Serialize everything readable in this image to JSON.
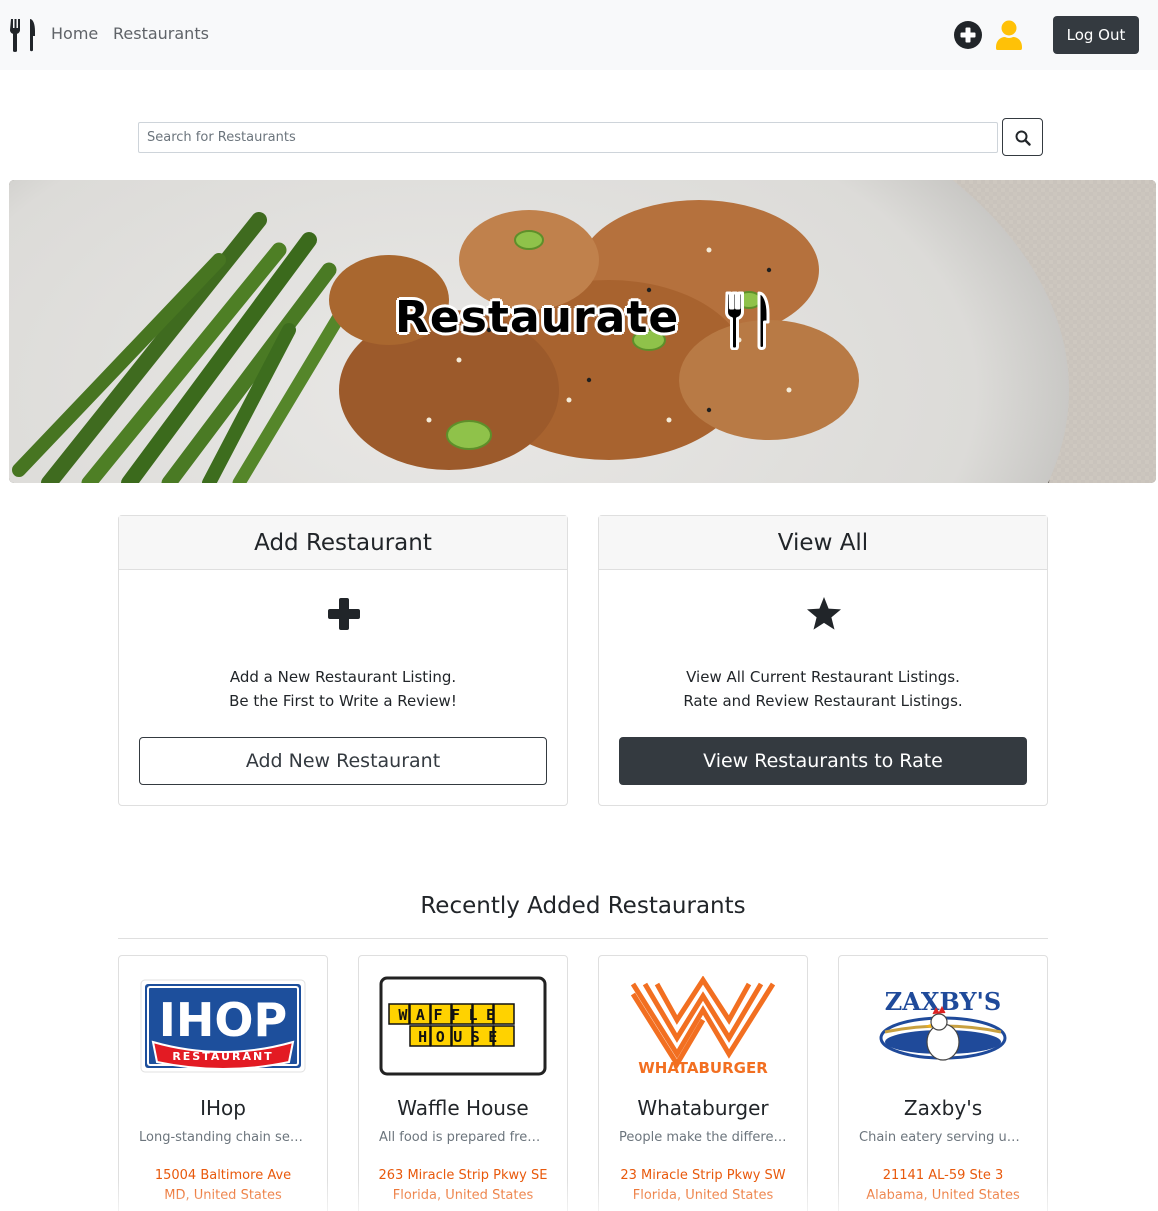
{
  "nav": {
    "home_label": "Home",
    "restaurants_label": "Restaurants",
    "logout_label": "Log Out",
    "icons": {
      "logo": "utensils-icon",
      "add": "plus-circle-icon",
      "user": "user-icon"
    },
    "user_icon_color": "#ffc107"
  },
  "search": {
    "placeholder": "Search for Restaurants",
    "value": ""
  },
  "hero": {
    "title": "Restaurate"
  },
  "cards": [
    {
      "header": "Add Restaurant",
      "icon": "plus-icon",
      "line1": "Add a New Restaurant Listing.",
      "line2": "Be the First to Write a Review!",
      "button_label": "Add New Restaurant"
    },
    {
      "header": "View All",
      "icon": "star-icon",
      "line1": "View All Current Restaurant Listings.",
      "line2": "Rate and Review Restaurant Listings.",
      "button_label": "View Restaurants to Rate"
    }
  ],
  "recent": {
    "title": "Recently Added Restaurants",
    "items": [
      {
        "name": "IHop",
        "description": "Long-standing chain serving classic American breakfast",
        "address1": "15004 Baltimore Ave",
        "address2": "MD, United States",
        "logo_text": "IHOP",
        "logo_subtext": "RESTAURANT"
      },
      {
        "name": "Waffle House",
        "description": "All food is prepared fresh to order",
        "address1": "263 Miracle Strip Pkwy SE",
        "address2": "Florida, United States",
        "logo_text": "WAFFLE HOUSE"
      },
      {
        "name": "Whataburger",
        "description": "People make the difference at Whataburger",
        "address1": "23 Miracle Strip Pkwy SW",
        "address2": "Florida, United States",
        "logo_text": "WHATABURGER"
      },
      {
        "name": "Zaxby's",
        "description": "Chain eatery serving up chicken fingers and wings",
        "address1": "21141 AL-59 Ste 3",
        "address2": "Alabama, United States",
        "logo_text": "ZAXBY'S"
      }
    ]
  },
  "colors": {
    "navbar_bg": "#f8f9fa",
    "dark": "#343a40",
    "address": "#e8590c",
    "muted": "#6c757d"
  }
}
